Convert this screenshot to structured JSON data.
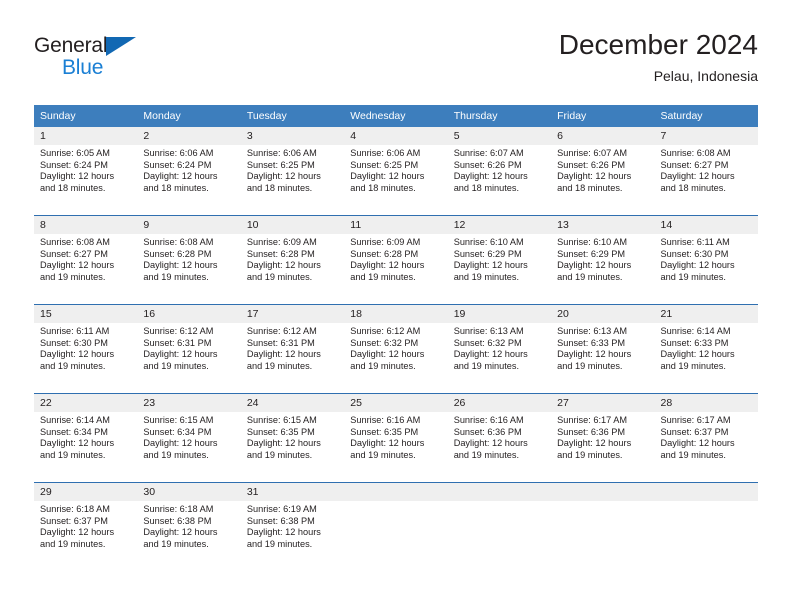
{
  "brand": {
    "name_part1": "General",
    "name_part2": "Blue",
    "triangle_color": "#1268b3",
    "blue_color": "#1a7fd4"
  },
  "header": {
    "title": "December 2024",
    "subtitle": "Pelau, Indonesia"
  },
  "theme": {
    "header_blue": "#3d7ebd",
    "row_separator": "#2f6fb0",
    "daynum_band": "#efefef",
    "text": "#231f20"
  },
  "calendar": {
    "weekdays": [
      "Sunday",
      "Monday",
      "Tuesday",
      "Wednesday",
      "Thursday",
      "Friday",
      "Saturday"
    ],
    "weeks": [
      [
        {
          "day": "1",
          "sunrise": "Sunrise: 6:05 AM",
          "sunset": "Sunset: 6:24 PM",
          "daylight_line1": "Daylight: 12 hours",
          "daylight_line2": "and 18 minutes."
        },
        {
          "day": "2",
          "sunrise": "Sunrise: 6:06 AM",
          "sunset": "Sunset: 6:24 PM",
          "daylight_line1": "Daylight: 12 hours",
          "daylight_line2": "and 18 minutes."
        },
        {
          "day": "3",
          "sunrise": "Sunrise: 6:06 AM",
          "sunset": "Sunset: 6:25 PM",
          "daylight_line1": "Daylight: 12 hours",
          "daylight_line2": "and 18 minutes."
        },
        {
          "day": "4",
          "sunrise": "Sunrise: 6:06 AM",
          "sunset": "Sunset: 6:25 PM",
          "daylight_line1": "Daylight: 12 hours",
          "daylight_line2": "and 18 minutes."
        },
        {
          "day": "5",
          "sunrise": "Sunrise: 6:07 AM",
          "sunset": "Sunset: 6:26 PM",
          "daylight_line1": "Daylight: 12 hours",
          "daylight_line2": "and 18 minutes."
        },
        {
          "day": "6",
          "sunrise": "Sunrise: 6:07 AM",
          "sunset": "Sunset: 6:26 PM",
          "daylight_line1": "Daylight: 12 hours",
          "daylight_line2": "and 18 minutes."
        },
        {
          "day": "7",
          "sunrise": "Sunrise: 6:08 AM",
          "sunset": "Sunset: 6:27 PM",
          "daylight_line1": "Daylight: 12 hours",
          "daylight_line2": "and 18 minutes."
        }
      ],
      [
        {
          "day": "8",
          "sunrise": "Sunrise: 6:08 AM",
          "sunset": "Sunset: 6:27 PM",
          "daylight_line1": "Daylight: 12 hours",
          "daylight_line2": "and 19 minutes."
        },
        {
          "day": "9",
          "sunrise": "Sunrise: 6:08 AM",
          "sunset": "Sunset: 6:28 PM",
          "daylight_line1": "Daylight: 12 hours",
          "daylight_line2": "and 19 minutes."
        },
        {
          "day": "10",
          "sunrise": "Sunrise: 6:09 AM",
          "sunset": "Sunset: 6:28 PM",
          "daylight_line1": "Daylight: 12 hours",
          "daylight_line2": "and 19 minutes."
        },
        {
          "day": "11",
          "sunrise": "Sunrise: 6:09 AM",
          "sunset": "Sunset: 6:28 PM",
          "daylight_line1": "Daylight: 12 hours",
          "daylight_line2": "and 19 minutes."
        },
        {
          "day": "12",
          "sunrise": "Sunrise: 6:10 AM",
          "sunset": "Sunset: 6:29 PM",
          "daylight_line1": "Daylight: 12 hours",
          "daylight_line2": "and 19 minutes."
        },
        {
          "day": "13",
          "sunrise": "Sunrise: 6:10 AM",
          "sunset": "Sunset: 6:29 PM",
          "daylight_line1": "Daylight: 12 hours",
          "daylight_line2": "and 19 minutes."
        },
        {
          "day": "14",
          "sunrise": "Sunrise: 6:11 AM",
          "sunset": "Sunset: 6:30 PM",
          "daylight_line1": "Daylight: 12 hours",
          "daylight_line2": "and 19 minutes."
        }
      ],
      [
        {
          "day": "15",
          "sunrise": "Sunrise: 6:11 AM",
          "sunset": "Sunset: 6:30 PM",
          "daylight_line1": "Daylight: 12 hours",
          "daylight_line2": "and 19 minutes."
        },
        {
          "day": "16",
          "sunrise": "Sunrise: 6:12 AM",
          "sunset": "Sunset: 6:31 PM",
          "daylight_line1": "Daylight: 12 hours",
          "daylight_line2": "and 19 minutes."
        },
        {
          "day": "17",
          "sunrise": "Sunrise: 6:12 AM",
          "sunset": "Sunset: 6:31 PM",
          "daylight_line1": "Daylight: 12 hours",
          "daylight_line2": "and 19 minutes."
        },
        {
          "day": "18",
          "sunrise": "Sunrise: 6:12 AM",
          "sunset": "Sunset: 6:32 PM",
          "daylight_line1": "Daylight: 12 hours",
          "daylight_line2": "and 19 minutes."
        },
        {
          "day": "19",
          "sunrise": "Sunrise: 6:13 AM",
          "sunset": "Sunset: 6:32 PM",
          "daylight_line1": "Daylight: 12 hours",
          "daylight_line2": "and 19 minutes."
        },
        {
          "day": "20",
          "sunrise": "Sunrise: 6:13 AM",
          "sunset": "Sunset: 6:33 PM",
          "daylight_line1": "Daylight: 12 hours",
          "daylight_line2": "and 19 minutes."
        },
        {
          "day": "21",
          "sunrise": "Sunrise: 6:14 AM",
          "sunset": "Sunset: 6:33 PM",
          "daylight_line1": "Daylight: 12 hours",
          "daylight_line2": "and 19 minutes."
        }
      ],
      [
        {
          "day": "22",
          "sunrise": "Sunrise: 6:14 AM",
          "sunset": "Sunset: 6:34 PM",
          "daylight_line1": "Daylight: 12 hours",
          "daylight_line2": "and 19 minutes."
        },
        {
          "day": "23",
          "sunrise": "Sunrise: 6:15 AM",
          "sunset": "Sunset: 6:34 PM",
          "daylight_line1": "Daylight: 12 hours",
          "daylight_line2": "and 19 minutes."
        },
        {
          "day": "24",
          "sunrise": "Sunrise: 6:15 AM",
          "sunset": "Sunset: 6:35 PM",
          "daylight_line1": "Daylight: 12 hours",
          "daylight_line2": "and 19 minutes."
        },
        {
          "day": "25",
          "sunrise": "Sunrise: 6:16 AM",
          "sunset": "Sunset: 6:35 PM",
          "daylight_line1": "Daylight: 12 hours",
          "daylight_line2": "and 19 minutes."
        },
        {
          "day": "26",
          "sunrise": "Sunrise: 6:16 AM",
          "sunset": "Sunset: 6:36 PM",
          "daylight_line1": "Daylight: 12 hours",
          "daylight_line2": "and 19 minutes."
        },
        {
          "day": "27",
          "sunrise": "Sunrise: 6:17 AM",
          "sunset": "Sunset: 6:36 PM",
          "daylight_line1": "Daylight: 12 hours",
          "daylight_line2": "and 19 minutes."
        },
        {
          "day": "28",
          "sunrise": "Sunrise: 6:17 AM",
          "sunset": "Sunset: 6:37 PM",
          "daylight_line1": "Daylight: 12 hours",
          "daylight_line2": "and 19 minutes."
        }
      ],
      [
        {
          "day": "29",
          "sunrise": "Sunrise: 6:18 AM",
          "sunset": "Sunset: 6:37 PM",
          "daylight_line1": "Daylight: 12 hours",
          "daylight_line2": "and 19 minutes."
        },
        {
          "day": "30",
          "sunrise": "Sunrise: 6:18 AM",
          "sunset": "Sunset: 6:38 PM",
          "daylight_line1": "Daylight: 12 hours",
          "daylight_line2": "and 19 minutes."
        },
        {
          "day": "31",
          "sunrise": "Sunrise: 6:19 AM",
          "sunset": "Sunset: 6:38 PM",
          "daylight_line1": "Daylight: 12 hours",
          "daylight_line2": "and 19 minutes."
        },
        {
          "day": "",
          "sunrise": "",
          "sunset": "",
          "daylight_line1": "",
          "daylight_line2": ""
        },
        {
          "day": "",
          "sunrise": "",
          "sunset": "",
          "daylight_line1": "",
          "daylight_line2": ""
        },
        {
          "day": "",
          "sunrise": "",
          "sunset": "",
          "daylight_line1": "",
          "daylight_line2": ""
        },
        {
          "day": "",
          "sunrise": "",
          "sunset": "",
          "daylight_line1": "",
          "daylight_line2": ""
        }
      ]
    ]
  }
}
